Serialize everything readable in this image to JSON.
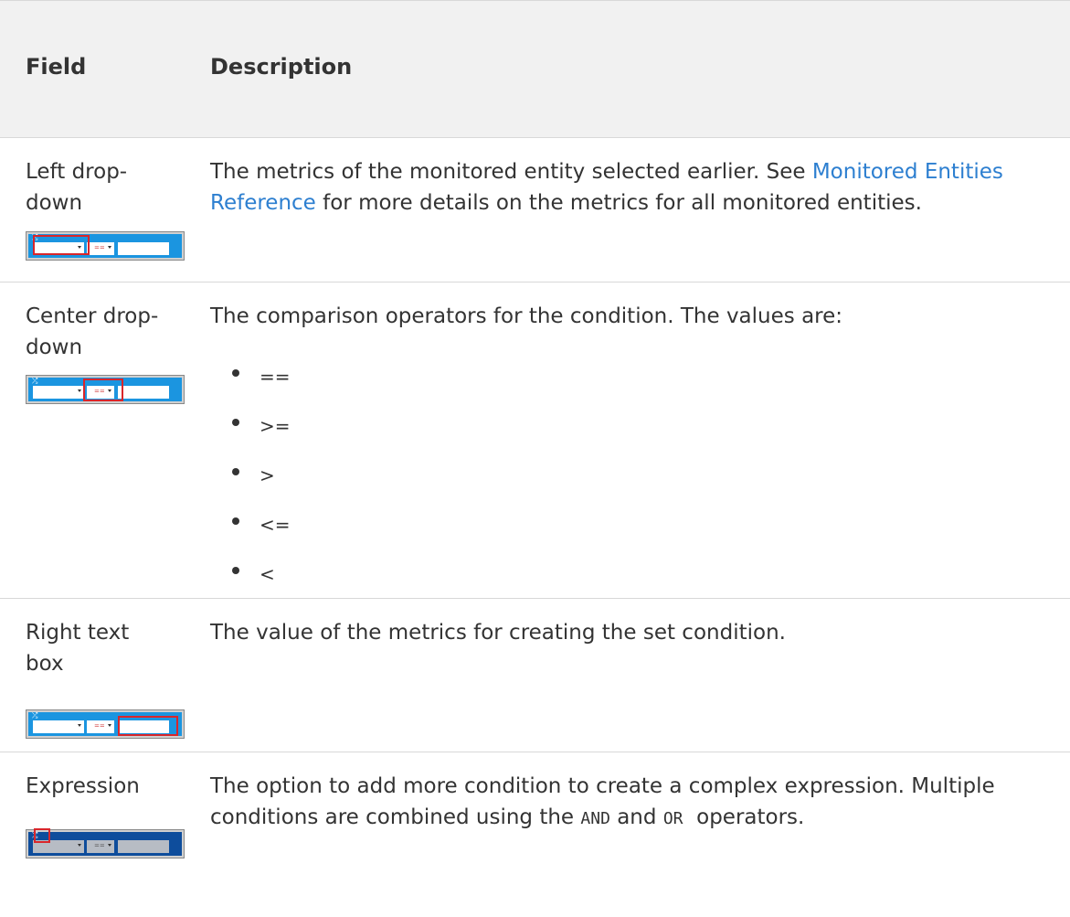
{
  "table": {
    "headers": {
      "field": "Field",
      "description": "Description"
    },
    "rows": [
      {
        "field": "Left drop-down",
        "description_before": "The metrics of the monitored entity selected earlier. See ",
        "link_text": "Monitored Entities Reference",
        "description_after": " for more details on the metrics for all monitored entities."
      },
      {
        "field": "Center drop-down",
        "description": "The comparison operators for the condition. The values are:",
        "values": [
          "==",
          ">=",
          ">",
          "<=",
          "<"
        ]
      },
      {
        "field": "Right text box",
        "description": "The value of the metrics for creating the set condition."
      },
      {
        "field": "Expression",
        "description_before": "The option to add more condition to create a complex expression. Multiple conditions are combined using the ",
        "code_and": "AND",
        "description_mid": " and ",
        "code_or": "OR",
        "description_after": "  operators."
      }
    ]
  },
  "widget": {
    "operator_label": "==",
    "icon": "shuffle-icon",
    "highlight_color": "#d9262b",
    "accent_color": "#1b95e0",
    "dark_color": "#0e4d9c"
  },
  "colors": {
    "link": "#2d7fd0",
    "header_bg": "#f1f1f1",
    "text": "#333333"
  }
}
